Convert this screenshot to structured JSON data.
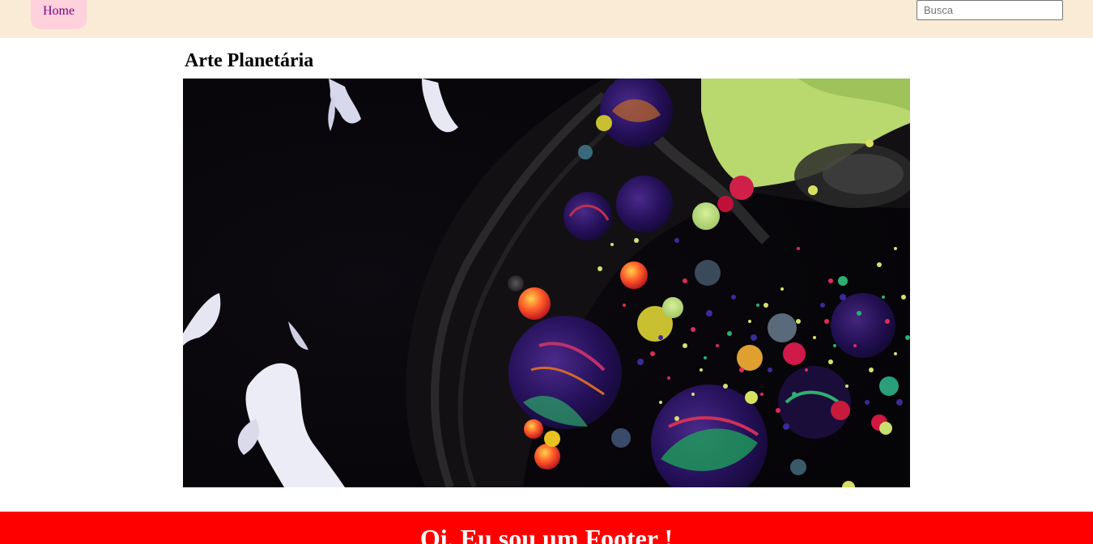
{
  "nav": {
    "home_label": "Home",
    "search_placeholder": "Busca",
    "search_value": ""
  },
  "main": {
    "title": "Arte Planetária",
    "image_alt": "Arte Planetária"
  },
  "footer": {
    "text": "Oi, Eu sou um Footer !"
  },
  "colors": {
    "topbar_bg": "#faebd7",
    "home_button_bg": "#ffd1dc",
    "home_link_text": "#800080",
    "footer_bg": "#ff0000",
    "footer_text": "#ffffff"
  }
}
